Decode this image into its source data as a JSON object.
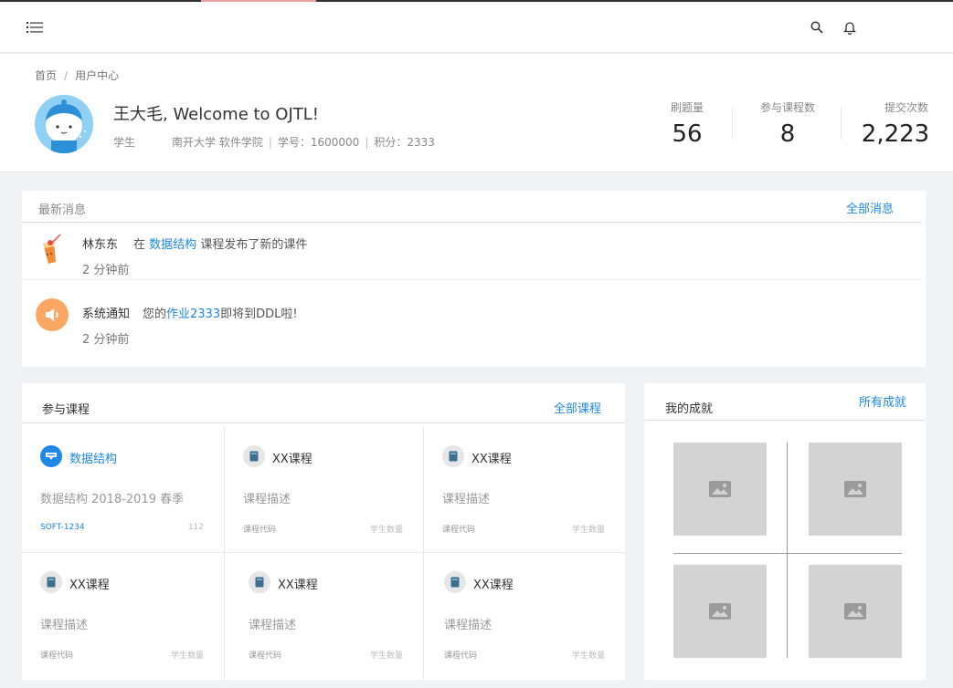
{
  "header": {
    "menu_icon": "menu-list-icon",
    "search_icon": "search-icon",
    "bell_icon": "bell-icon"
  },
  "breadcrumb": {
    "home": "首页",
    "separator": "/",
    "current": "用户中心"
  },
  "profile": {
    "welcome": "王大毛, Welcome to OJTL!",
    "role": "学生",
    "school": "南开大学 软件学院",
    "student_id": "学号：1600000",
    "points": "积分：2333",
    "bar": "|"
  },
  "stats": [
    {
      "label": "刷题量",
      "value": "56"
    },
    {
      "label": "参与课程数",
      "value": "8"
    },
    {
      "label": "提交次数",
      "value": "2,223"
    }
  ],
  "news": {
    "title": "最新消息",
    "all_link": "全部消息",
    "items": [
      {
        "who": "林东东",
        "pre": "在",
        "link": "数据结构",
        "post": "课程发布了新的课件",
        "time": "2 分钟前",
        "icon": "drink-avatar-icon"
      },
      {
        "who": "系统通知",
        "pre": "您的",
        "link": "作业2333",
        "post": "即将到DDL啦!",
        "time": "2 分钟前",
        "icon": "speaker-icon"
      }
    ]
  },
  "courses": {
    "title": "参与课程",
    "all_link": "全部课程",
    "items": [
      {
        "name": "数据结构",
        "desc": "数据结构 2018-2019 春季",
        "code": "SOFT-1234",
        "count": "112",
        "icon": "course-active-icon"
      },
      {
        "name": "XX课程",
        "desc": "课程描述",
        "code": "课程代码",
        "count": "学生数量",
        "icon": "book-icon"
      },
      {
        "name": "XX课程",
        "desc": "课程描述",
        "code": "课程代码",
        "count": "学生数量",
        "icon": "book-icon"
      },
      {
        "name": "XX课程",
        "desc": "课程描述",
        "code": "课程代码",
        "count": "学生数量",
        "icon": "book-icon"
      },
      {
        "name": "XX课程",
        "desc": "课程描述",
        "code": "课程代码",
        "count": "学生数量",
        "icon": "book-icon"
      },
      {
        "name": "XX课程",
        "desc": "课程描述",
        "code": "课程代码",
        "count": "学生数量",
        "icon": "book-icon"
      }
    ]
  },
  "achievements": {
    "title": "我的成就",
    "all_link": "所有成就",
    "items": [
      "image-placeholder-icon",
      "image-placeholder-icon",
      "image-placeholder-icon",
      "image-placeholder-icon"
    ]
  },
  "colors": {
    "accent": "#1e88e5",
    "background": "#f0f2f5",
    "speaker_bg": "#fba764",
    "placeholder": "#d3d3d3"
  }
}
